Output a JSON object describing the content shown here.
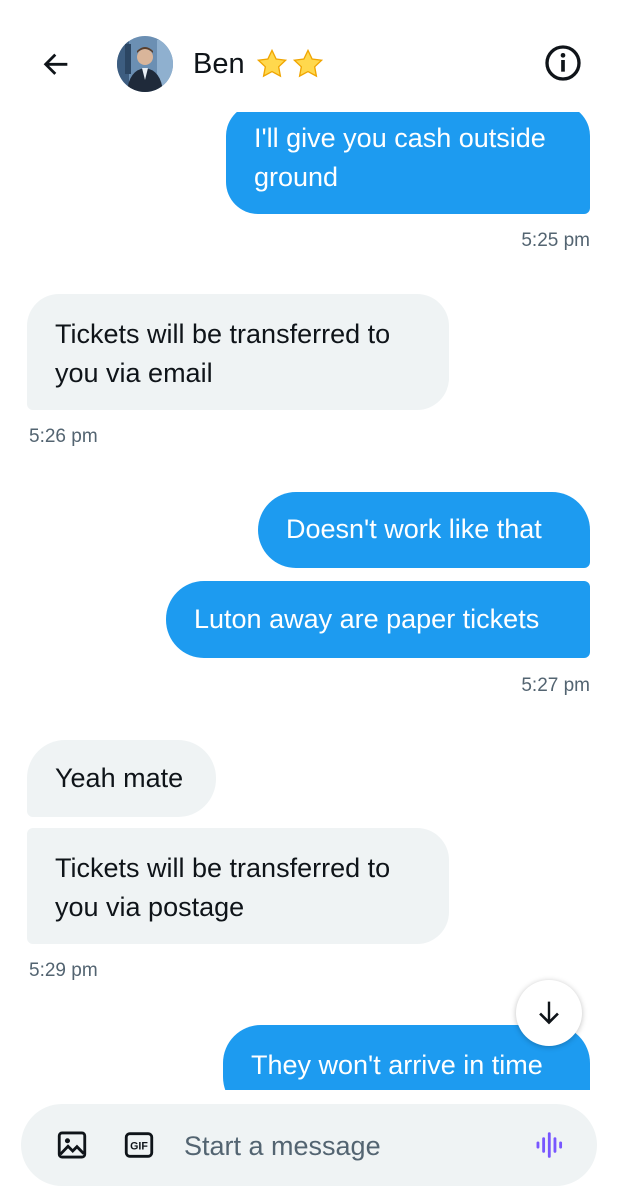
{
  "header": {
    "contact_name": "Ben",
    "stars": 2,
    "icons": {
      "back": "arrow-left-icon",
      "info": "info-icon"
    }
  },
  "messages": [
    {
      "side": "out",
      "text": "I'll give you cash outside ground"
    },
    {
      "side": "out-timestamp",
      "text": "5:25 pm"
    },
    {
      "side": "in",
      "text": "Tickets will be transferred to you via email"
    },
    {
      "side": "in-timestamp",
      "text": "5:26 pm"
    },
    {
      "side": "out",
      "text": "Doesn't work like that"
    },
    {
      "side": "out",
      "text": "Luton away are paper tickets"
    },
    {
      "side": "out-timestamp",
      "text": "5:27 pm"
    },
    {
      "side": "in",
      "text": "Yeah mate"
    },
    {
      "side": "in",
      "text": "Tickets will be transferred to you via postage"
    },
    {
      "side": "in-timestamp",
      "text": "5:29 pm"
    },
    {
      "side": "out",
      "text": "They won't arrive in time"
    }
  ],
  "composer": {
    "placeholder": "Start a message",
    "icons": {
      "media": "image-icon",
      "gif": "gif-icon",
      "voice": "voice-waveform-icon"
    }
  },
  "colors": {
    "accent": "#1d9bf0",
    "incoming_bubble": "#eff3f4",
    "muted_text": "#536471",
    "voice_icon": "#7856ff",
    "star": "#ffd84d"
  }
}
